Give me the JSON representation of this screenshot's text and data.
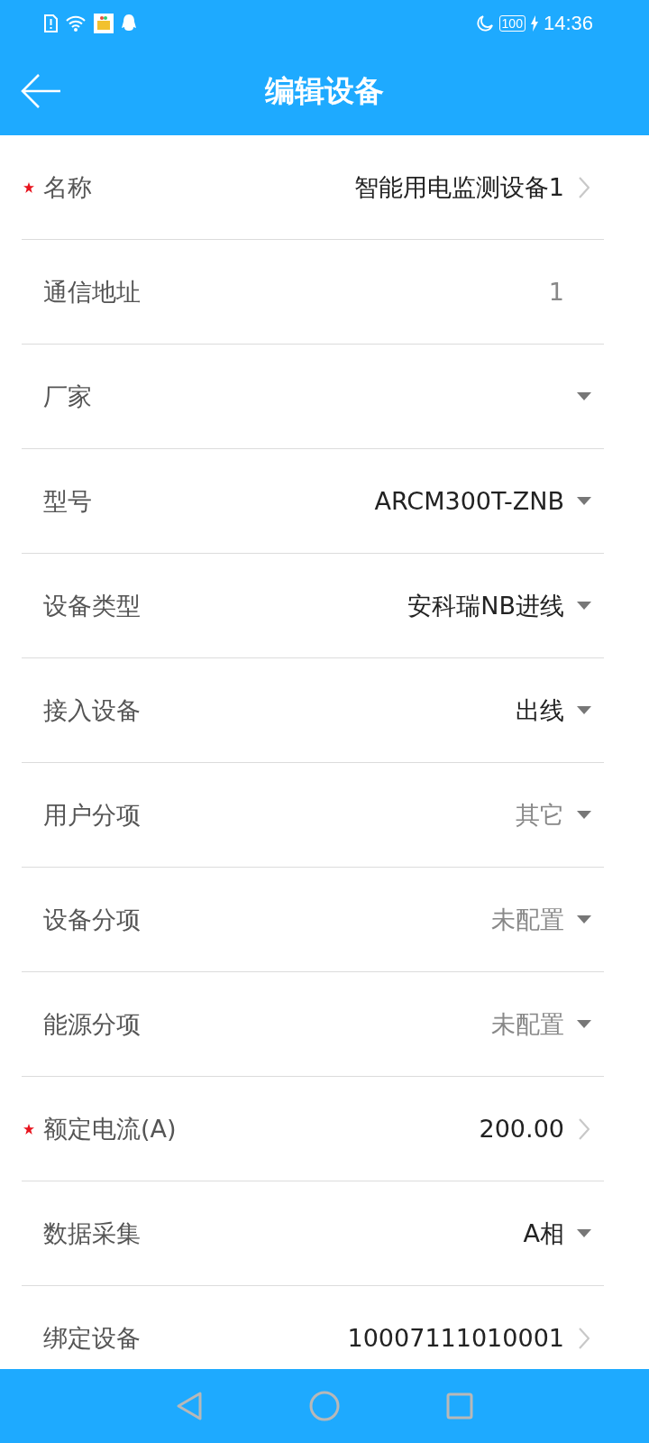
{
  "status_bar": {
    "battery": "100",
    "time": "14:36"
  },
  "header": {
    "title": "编辑设备"
  },
  "fields": [
    {
      "label": "名称",
      "value": "智能用电监测设备1",
      "kind": "link",
      "required": true,
      "dimmed": false
    },
    {
      "label": "通信地址",
      "value": "1",
      "kind": "plain",
      "required": false,
      "dimmed": true
    },
    {
      "label": "厂家",
      "kind": "dropdown",
      "required": false,
      "dimmed": false
    },
    {
      "label": "型号",
      "value": "ARCM300T-ZNB",
      "kind": "dropdown",
      "required": false,
      "dimmed": false
    },
    {
      "label": "设备类型",
      "value": "安科瑞NB进线",
      "kind": "dropdown",
      "required": false,
      "dimmed": false
    },
    {
      "label": "接入设备",
      "value": "出线",
      "kind": "dropdown",
      "required": false,
      "dimmed": false
    },
    {
      "label": "用户分项",
      "value": "其它",
      "kind": "dropdown",
      "required": false,
      "dimmed": true
    },
    {
      "label": "设备分项",
      "value": "未配置",
      "kind": "dropdown",
      "required": false,
      "dimmed": true
    },
    {
      "label": "能源分项",
      "value": "未配置",
      "kind": "dropdown",
      "required": false,
      "dimmed": true
    },
    {
      "label": "额定电流(A)",
      "value": "200.00",
      "kind": "link",
      "required": true,
      "dimmed": false
    },
    {
      "label": "数据采集",
      "value": "A相",
      "kind": "dropdown",
      "required": false,
      "dimmed": false
    },
    {
      "label": "绑定设备",
      "value": "10007111010001",
      "kind": "link",
      "required": false,
      "dimmed": false
    }
  ]
}
